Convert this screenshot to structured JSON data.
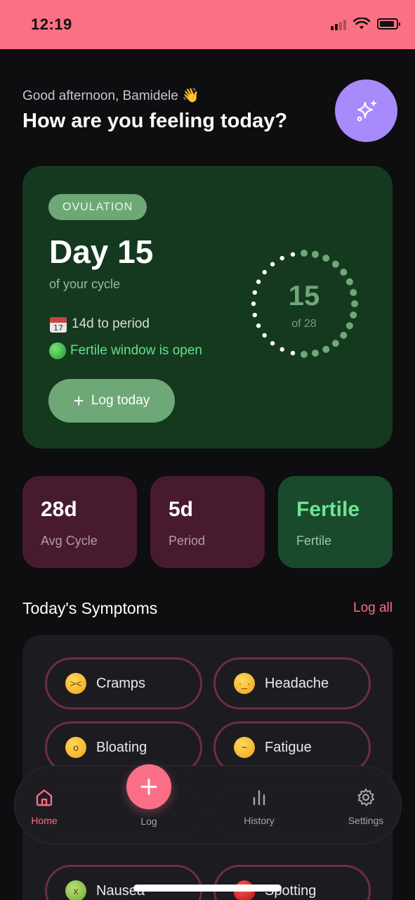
{
  "status_bar": {
    "time": "12:19"
  },
  "header": {
    "greeting": "Good afternoon, Bamidele",
    "greeting_emoji": "👋",
    "headline": "How are you feeling today?",
    "ai_button_icon": "sparkle-icon"
  },
  "cycle_card": {
    "phase": "OVULATION",
    "day_title": "Day 15",
    "day_subtitle": "of your cycle",
    "period_countdown": "14d to period",
    "fertile_status": "Fertile window is open",
    "log_button": "Log today",
    "ring_day": "15",
    "ring_total": "of 28",
    "ring_progress": 0.536,
    "accent_color": "#6fa877"
  },
  "stats": [
    {
      "value": "28d",
      "label": "Avg Cycle",
      "variant": "rose"
    },
    {
      "value": "5d",
      "label": "Period",
      "variant": "rose"
    },
    {
      "value": "Fertile",
      "label": "Fertile",
      "variant": "green"
    }
  ],
  "symptoms": {
    "title": "Today's Symptoms",
    "log_all": "Log all",
    "items": [
      {
        "label": "Cramps",
        "icon": "persevering-face-icon"
      },
      {
        "label": "Headache",
        "icon": "bandaged-head-face-icon"
      },
      {
        "label": "Bloating",
        "icon": "surprised-face-icon"
      },
      {
        "label": "Fatigue",
        "icon": "yawning-face-icon"
      },
      {
        "label": "Nausea",
        "icon": "nauseated-face-icon"
      },
      {
        "label": "Spotting",
        "icon": "drop-of-blood-icon"
      }
    ]
  },
  "nav": {
    "home": "Home",
    "log": "Log",
    "history": "History",
    "settings": "Settings"
  },
  "colors": {
    "status_bar": "#fb7184",
    "background": "#0e0d10",
    "primary": "#fb6f86",
    "fertile_green": "#66e08a",
    "ai_purple": "#a78bfa"
  }
}
